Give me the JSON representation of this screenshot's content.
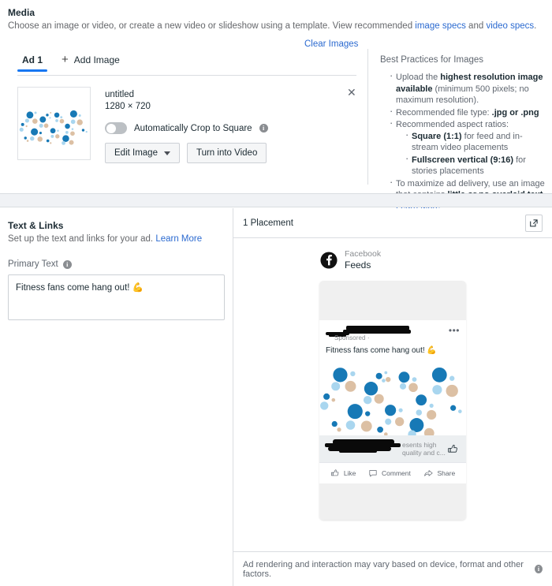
{
  "media": {
    "title": "Media",
    "subtitle_pre": "Choose an image or video, or create a new video or slideshow using a template. View recommended ",
    "link_image_specs": "image specs",
    "subtitle_mid": " and ",
    "link_video_specs": "video specs",
    "subtitle_end": ".",
    "clear_images": "Clear Images",
    "tab_ad1": "Ad 1",
    "add_image": "+ Add Image",
    "add_image_label": "Add Image",
    "close_glyph": "✕",
    "thumbnail": {
      "name": "untitled",
      "dimensions": "1280 × 720"
    },
    "crop_toggle_label": "Automatically Crop to Square",
    "crop_toggle_on": false,
    "edit_image_button": "Edit Image",
    "turn_into_video_button": "Turn into Video"
  },
  "best_practices": {
    "title": "Best Practices for Images",
    "items": [
      {
        "parts": [
          {
            "t": "Upload the ",
            "b": false
          },
          {
            "t": "highest resolution image available",
            "b": true
          },
          {
            "t": " (minimum 500 pixels; no maximum resolution).",
            "b": false
          }
        ]
      },
      {
        "parts": [
          {
            "t": "Recommended file type: ",
            "b": false
          },
          {
            "t": ".jpg or .png",
            "b": true
          }
        ]
      },
      {
        "parts": [
          {
            "t": "Recommended aspect ratios:",
            "b": false
          }
        ],
        "children": [
          {
            "parts": [
              {
                "t": "Square (1:1)",
                "b": true
              },
              {
                "t": " for feed and in-stream video placements",
                "b": false
              }
            ]
          },
          {
            "parts": [
              {
                "t": "Fullscreen vertical (9:16)",
                "b": true
              },
              {
                "t": " for stories placements",
                "b": false
              }
            ]
          }
        ]
      },
      {
        "parts": [
          {
            "t": "To maximize ad delivery, use an image that contains ",
            "b": false
          },
          {
            "t": "little or no overlaid text.",
            "b": true
          }
        ]
      }
    ],
    "learn_more": "Learn More"
  },
  "text_links": {
    "title": "Text & Links",
    "subtitle": "Set up the text and links for your ad. ",
    "learn_more": "Learn More",
    "primary_text_label": "Primary Text",
    "primary_text_value": "Fitness fans come hang out! 💪"
  },
  "preview": {
    "header_title": "1 Placement",
    "popout_icon": "external-link-icon",
    "platform_name": "Facebook",
    "platform_surface": "Feeds",
    "ad": {
      "sponsored_label": "Sponsored · ",
      "profile_name_redacted": true,
      "primary_text": "Fitness fans come hang out! 💪",
      "link_caption_visible": "esents high quality and c...",
      "link_caption_redacted": true,
      "more_options_glyph": "•••",
      "actions": [
        {
          "label": "Like",
          "icon": "thumbs-up-icon"
        },
        {
          "label": "Comment",
          "icon": "comment-icon"
        },
        {
          "label": "Share",
          "icon": "share-icon"
        }
      ]
    },
    "footer_note": "Ad rendering and interaction may vary based on device, format and other factors."
  },
  "colors": {
    "link": "#2b6ad0",
    "tab_active": "#1877f2",
    "dot_dark_blue": "#1779b6",
    "dot_light_blue": "#a9d6ef",
    "dot_tan": "#dcc0a4",
    "gray_placeholder": "#f0f0f0",
    "border": "#dadde1"
  }
}
